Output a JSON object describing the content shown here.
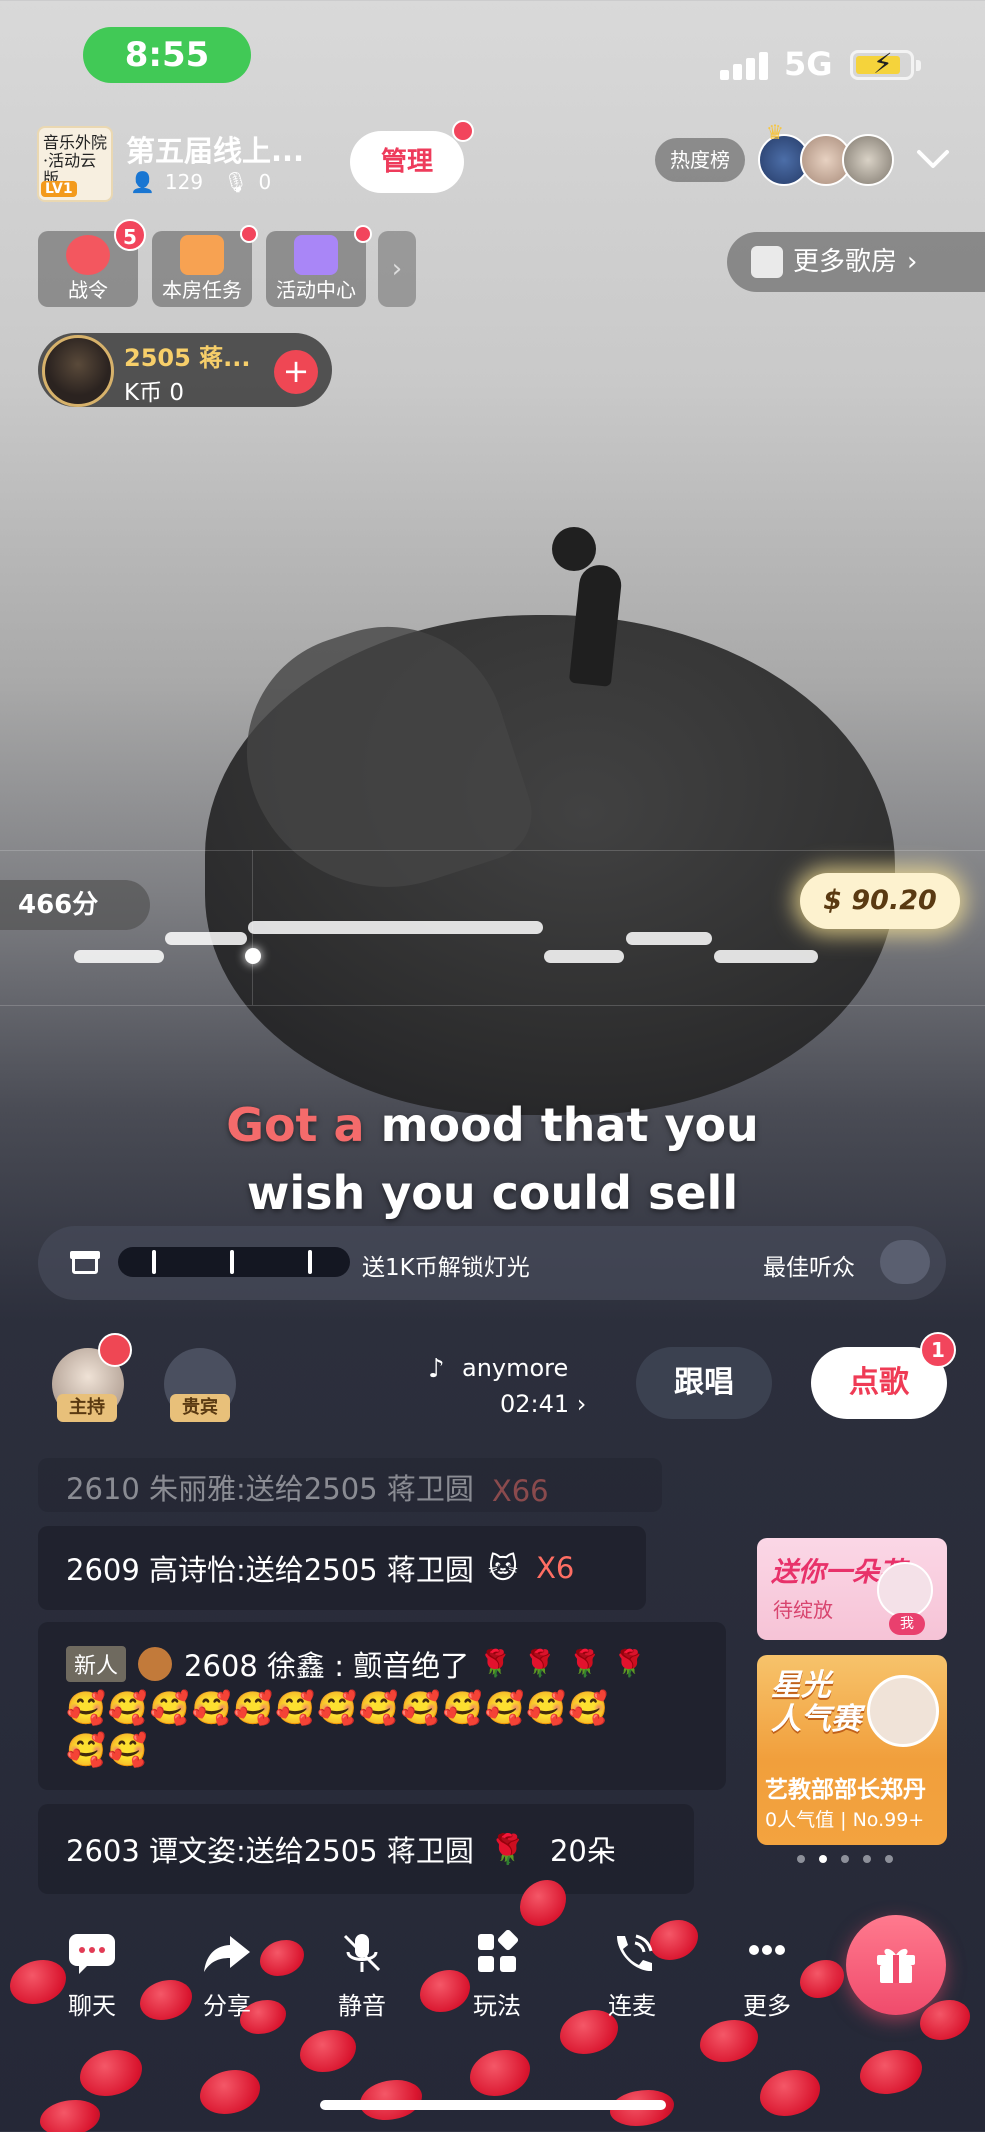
{
  "status_bar": {
    "time": "8:55",
    "network": "5G"
  },
  "room": {
    "thumb_text": "音乐外院·活动云版",
    "thumb_level": "LV1",
    "title": "第五届线上...",
    "listeners": "129",
    "mic_count": "0",
    "manage_label": "管理",
    "hot_rank_label": "热度榜"
  },
  "tiles": [
    {
      "label": "战令",
      "badge": "5",
      "color": "#f3575f"
    },
    {
      "label": "本房任务",
      "badge": "",
      "color": "#f7a252"
    },
    {
      "label": "活动中心",
      "badge": "",
      "color": "#a986f7"
    }
  ],
  "more_rooms_label": "更多歌房",
  "singer": {
    "name": "2505 蒋...",
    "coin": "K币 0"
  },
  "score": {
    "points": "466分",
    "coins": "90.20"
  },
  "lyrics": {
    "line1_sung": "Got a ",
    "line1_rest": "mood that you",
    "line2": "wish you could sell"
  },
  "lighting": {
    "text": "送1K币解锁灯光",
    "best_listener": "最佳听众"
  },
  "seats": {
    "host_tag": "主持",
    "guest_tag": "贵宾"
  },
  "song": {
    "name": "anymore",
    "time": "02:41 ›",
    "sing_label": "跟唱",
    "order_label": "点歌",
    "order_badge": "1"
  },
  "chat": [
    {
      "text": "2610 朱丽雅:送给2505 蒋卫圆",
      "mult": "X66"
    },
    {
      "text": "2609 高诗怡:送给2505 蒋卫圆",
      "mult": "X6"
    },
    {
      "tag": "新人",
      "text": "2608 徐鑫 : 颤音绝了",
      "emoji_line1": "🌹 🌹 🌹 🌹",
      "emoji_line2": "🥰🥰🥰🥰🥰🥰🥰🥰🥰🥰🥰🥰🥰",
      "emoji_line3": "🥰🥰"
    },
    {
      "text": "2603 谭文姿:送给2505 蒋卫圆",
      "mult": "20朵"
    }
  ],
  "promo": {
    "card1_title": "送你一朵花",
    "card1_sub": "待绽放",
    "card1_me": "我",
    "card2_title_line1": "星光",
    "card2_title_line2": "人气赛",
    "card2_name": "艺教部部长郑丹",
    "card2_sub": "0人气值 | No.99+"
  },
  "toolbar": [
    {
      "label": "聊天"
    },
    {
      "label": "分享"
    },
    {
      "label": "静音"
    },
    {
      "label": "玩法"
    },
    {
      "label": "连麦"
    },
    {
      "label": "更多"
    }
  ]
}
